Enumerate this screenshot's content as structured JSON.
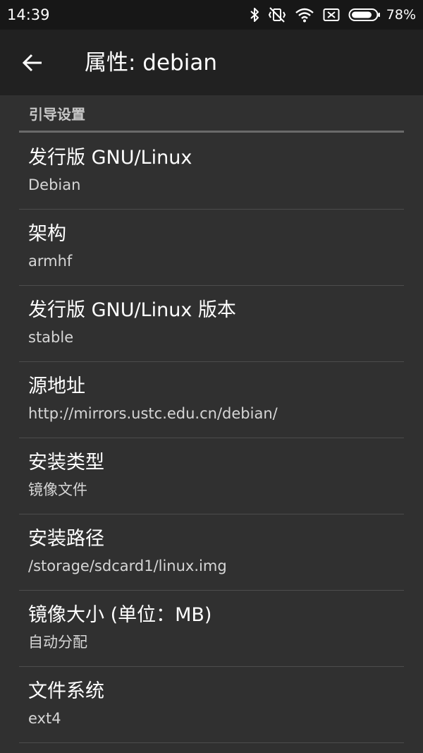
{
  "status_bar": {
    "time": "14:39",
    "battery_percent": "78%",
    "icons": [
      "bluetooth-icon",
      "vibrate-muted-icon",
      "wifi-icon",
      "no-sim-icon",
      "battery-icon"
    ]
  },
  "toolbar": {
    "back_icon": "arrow-left-icon",
    "title": "属性: debian"
  },
  "category": {
    "title": "引导设置"
  },
  "preferences": [
    {
      "title": "发行版 GNU/Linux",
      "summary": "Debian"
    },
    {
      "title": "架构",
      "summary": "armhf"
    },
    {
      "title": "发行版 GNU/Linux 版本",
      "summary": "stable"
    },
    {
      "title": "源地址",
      "summary": "http://mirrors.ustc.edu.cn/debian/"
    },
    {
      "title": "安装类型",
      "summary": "镜像文件"
    },
    {
      "title": "安装路径",
      "summary": "/storage/sdcard1/linux.img"
    },
    {
      "title": "镜像大小 (单位：MB)",
      "summary": "自动分配"
    },
    {
      "title": "文件系统",
      "summary": "ext4"
    }
  ],
  "colors": {
    "status_bar_bg": "#171717",
    "toolbar_bg": "#212121",
    "content_bg": "#303030",
    "title_text": "#ffffff",
    "summary_text": "#d6d6d6"
  }
}
